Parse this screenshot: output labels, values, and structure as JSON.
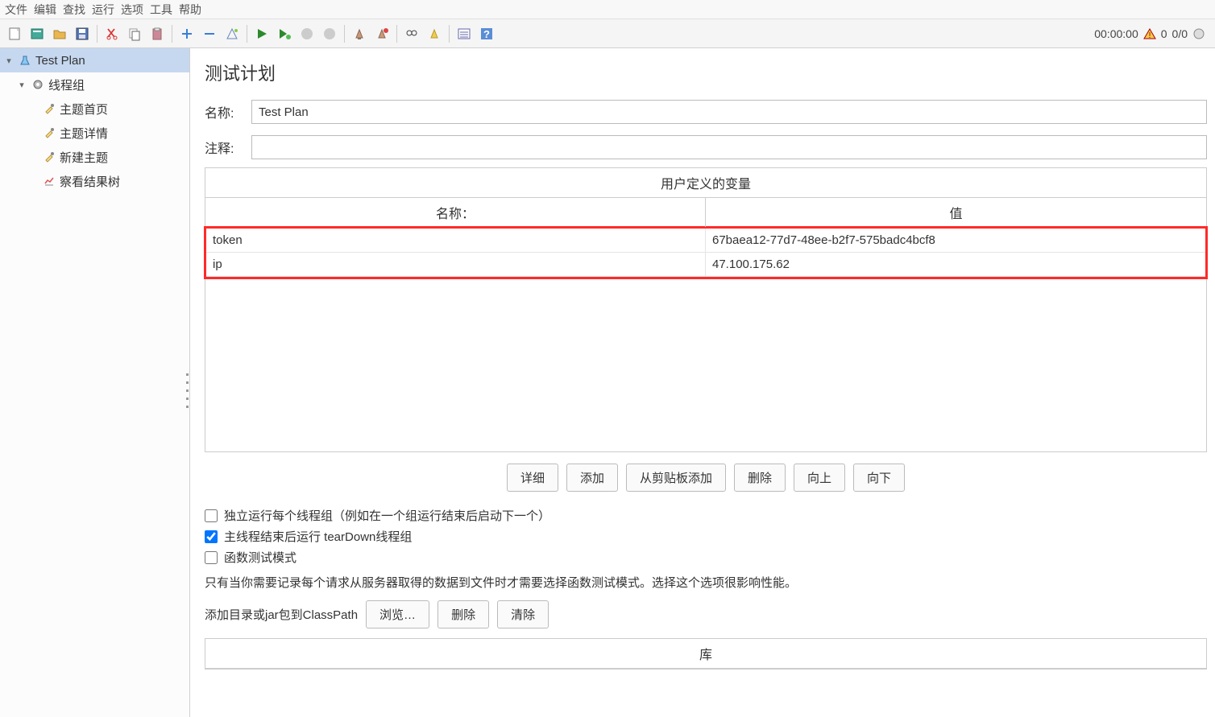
{
  "menu": {
    "file": "文件",
    "edit": "编辑",
    "search": "查找",
    "run": "运行",
    "options": "选项",
    "tools": "工具",
    "help": "帮助"
  },
  "status": {
    "time": "00:00:00",
    "warnings": "0",
    "progress": "0/0"
  },
  "tree": {
    "root": "Test Plan",
    "threadgroup": "线程组",
    "item_home": "主题首页",
    "item_detail": "主题详情",
    "item_new": "新建主题",
    "item_results": "察看结果树"
  },
  "panel": {
    "title": "测试计划",
    "name_label": "名称:",
    "name_value": "Test Plan",
    "comment_label": "注释:",
    "comment_value": ""
  },
  "vars": {
    "section_title": "用户定义的变量",
    "col_name": "名称：",
    "col_value": "值",
    "rows": [
      {
        "name": "token",
        "value": "67baea12-77d7-48ee-b2f7-575badc4bcf8"
      },
      {
        "name": "ip",
        "value": "47.100.175.62"
      }
    ]
  },
  "buttons": {
    "detail": "详细",
    "add": "添加",
    "from_clipboard": "从剪贴板添加",
    "delete": "删除",
    "up": "向上",
    "down": "向下"
  },
  "checks": {
    "independent": "独立运行每个线程组（例如在一个组运行结束后启动下一个）",
    "teardown": "主线程结束后运行 tearDown线程组",
    "funcmode": "函数测试模式"
  },
  "help": "只有当你需要记录每个请求从服务器取得的数据到文件时才需要选择函数测试模式。选择这个选项很影响性能。",
  "classpath": {
    "label": "添加目录或jar包到ClassPath",
    "browse": "浏览…",
    "delete": "删除",
    "clear": "清除"
  },
  "lib_title": "库"
}
